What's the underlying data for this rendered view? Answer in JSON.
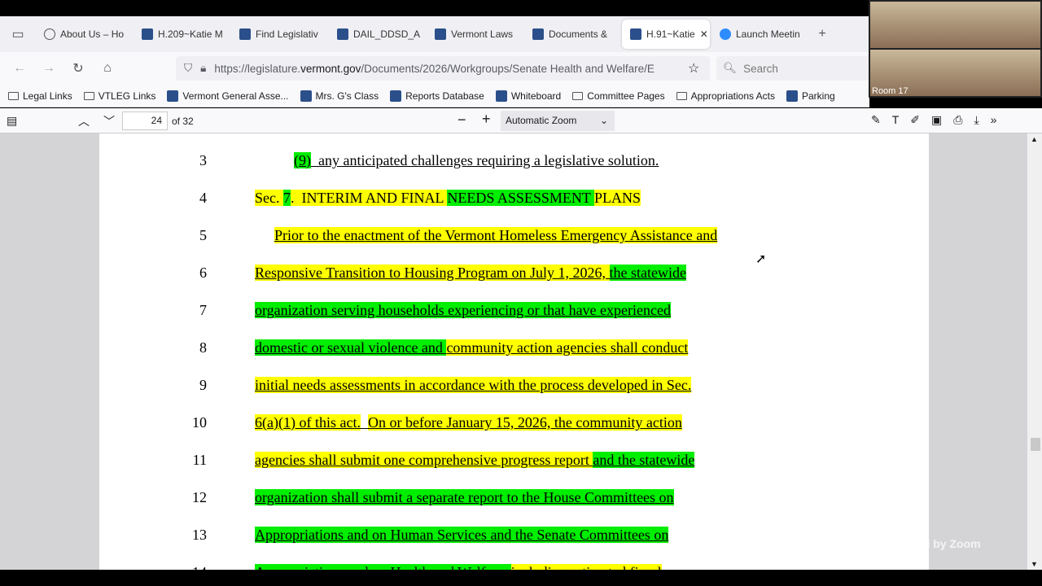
{
  "browser": {
    "tabs": [
      {
        "label": "About Us – Ho",
        "icon": "globe-icon"
      },
      {
        "label": "H.209~Katie M",
        "icon": "legislature-icon"
      },
      {
        "label": "Find Legislativ",
        "icon": "legislature-icon"
      },
      {
        "label": "DAIL_DDSD_A",
        "icon": "legislature-icon"
      },
      {
        "label": "Vermont Laws",
        "icon": "legislature-icon"
      },
      {
        "label": "Documents &",
        "icon": "legislature-icon"
      },
      {
        "label": "H.91~Katie",
        "icon": "legislature-icon",
        "active": true
      },
      {
        "label": "Launch Meetin",
        "icon": "zoom-icon"
      }
    ],
    "url_prefix": "https://legislature.",
    "url_domain": "vermont.gov",
    "url_path": "/Documents/2026/Workgroups/Senate Health and Welfare/E",
    "search_placeholder": "Search",
    "bookmarks": [
      "Legal Links",
      "VTLEG Links",
      "Vermont General Asse...",
      "Mrs. G's Class",
      "Reports Database",
      "Whiteboard",
      "Committee Pages",
      "Appropriations Acts",
      "Parking"
    ]
  },
  "pdf": {
    "page": "24",
    "of": "of 32",
    "zoom": "Automatic Zoom"
  },
  "document": {
    "lines": [
      {
        "n": "3",
        "indent": 48,
        "ul": true,
        "segs": [
          {
            "t": "(9)",
            "h": "green"
          },
          {
            "t": "  any anticipated challenges requiring a legislative solution.",
            "h": ""
          }
        ]
      },
      {
        "n": "4",
        "indent": 0,
        "ul": false,
        "segs": [
          {
            "t": "Sec. ",
            "h": "yellow"
          },
          {
            "t": "7",
            "h": "green"
          },
          {
            "t": ".  INTERIM AND FINAL ",
            "h": "yellow"
          },
          {
            "t": "NEEDS ASSESSMENT ",
            "h": "green"
          },
          {
            "t": "PLANS",
            "h": "yellow"
          }
        ]
      },
      {
        "n": "5",
        "indent": 24,
        "ul": true,
        "segs": [
          {
            "t": "Prior to the enactment of the Vermont Homeless Emergency Assistance and",
            "h": "yellow"
          }
        ]
      },
      {
        "n": "6",
        "indent": 0,
        "ul": true,
        "segs": [
          {
            "t": "Responsive Transition to Housing Program on July 1, 2026, ",
            "h": "yellow"
          },
          {
            "t": "the statewide",
            "h": "green"
          }
        ]
      },
      {
        "n": "7",
        "indent": 0,
        "ul": true,
        "segs": [
          {
            "t": "organization serving households experiencing or that have experienced",
            "h": "green"
          }
        ]
      },
      {
        "n": "8",
        "indent": 0,
        "ul": true,
        "segs": [
          {
            "t": "domestic or sexual violence and ",
            "h": "green"
          },
          {
            "t": "community action agencies shall conduct",
            "h": "yellow"
          }
        ]
      },
      {
        "n": "9",
        "indent": 0,
        "ul": true,
        "segs": [
          {
            "t": "initial needs assessments in accordance with the process developed in Sec.",
            "h": "yellow"
          }
        ]
      },
      {
        "n": "10",
        "indent": 0,
        "ul": true,
        "segs": [
          {
            "t": "6(a)(1) of this act.",
            "h": "yellow"
          },
          {
            "t": "  ",
            "h": ""
          },
          {
            "t": "On or before January 15, 2026, the community action",
            "h": "yellow"
          }
        ]
      },
      {
        "n": "11",
        "indent": 0,
        "ul": true,
        "segs": [
          {
            "t": "agencies shall submit one comprehensive progress report ",
            "h": "yellow"
          },
          {
            "t": "and the statewide",
            "h": "green"
          }
        ]
      },
      {
        "n": "12",
        "indent": 0,
        "ul": true,
        "segs": [
          {
            "t": "organization shall submit a separate report to the House Committees on",
            "h": "green"
          }
        ]
      },
      {
        "n": "13",
        "indent": 0,
        "ul": true,
        "segs": [
          {
            "t": "Appropriations and on Human Services and the Senate Committees on",
            "h": "green"
          }
        ]
      },
      {
        "n": "14",
        "indent": 0,
        "ul": true,
        "segs": [
          {
            "t": "Appropriations and on Health and Welfare, ",
            "h": "green"
          },
          {
            "t": "including estimated fiscal",
            "h": "yellow"
          }
        ]
      }
    ]
  },
  "zoom": {
    "room_label": "Room 17",
    "powered": "Powered by Zoom"
  }
}
